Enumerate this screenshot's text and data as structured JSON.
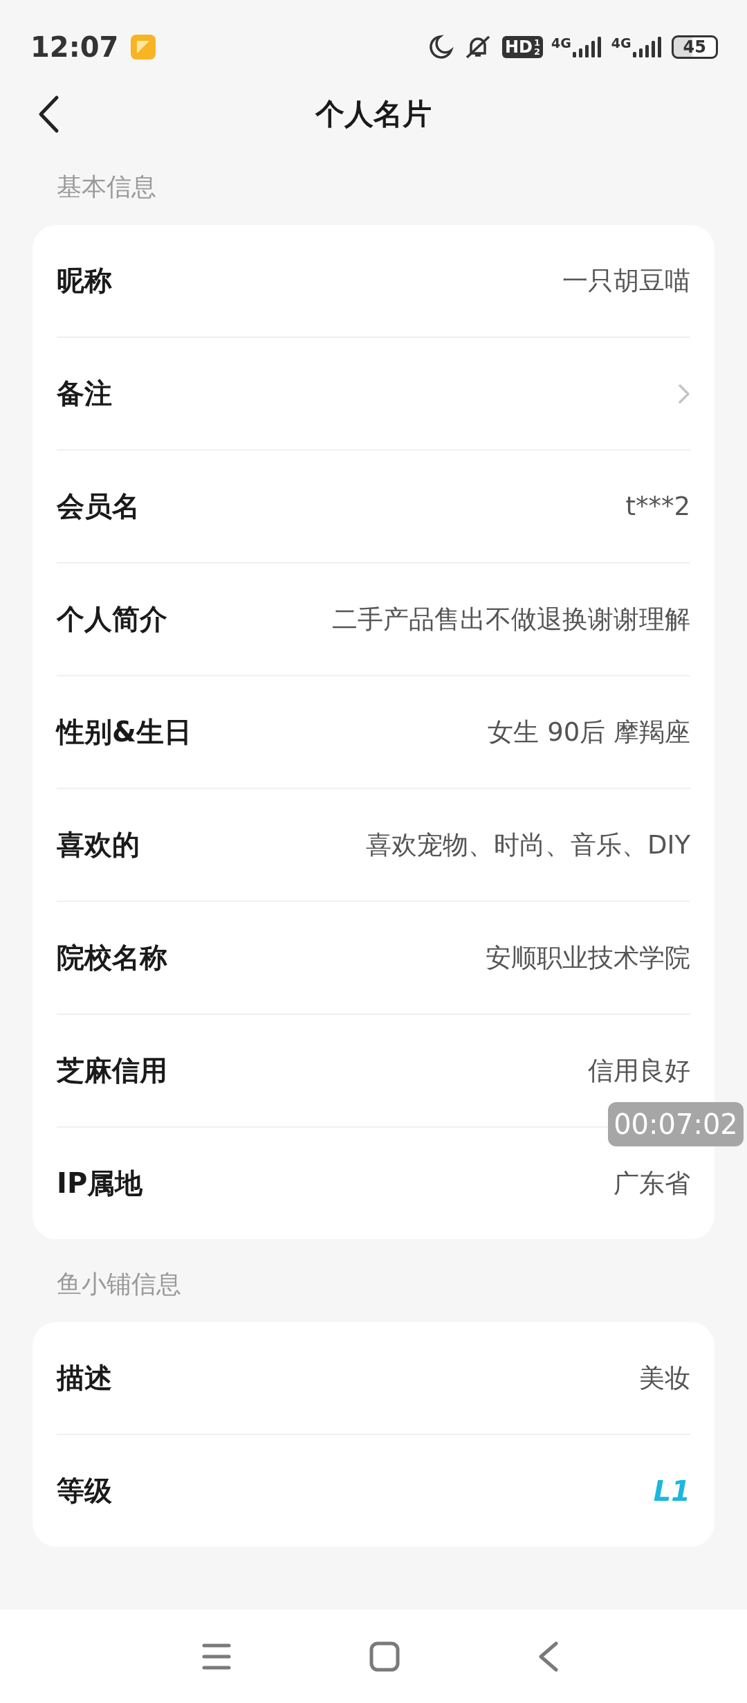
{
  "status_bar": {
    "time": "12:07",
    "hd_label": "HD",
    "hd_sup": "1",
    "hd_sub": "2",
    "network_1": "4G",
    "network_2": "4G",
    "battery": "45"
  },
  "header": {
    "title": "个人名片"
  },
  "sections": [
    {
      "title": "基本信息",
      "rows": [
        {
          "kind": "text",
          "label": "昵称",
          "value": "一只胡豆喵"
        },
        {
          "kind": "link",
          "label": "备注"
        },
        {
          "kind": "text",
          "label": "会员名",
          "value": "t***2"
        },
        {
          "kind": "text",
          "label": "个人简介",
          "value": "二手产品售出不做退换谢谢理解"
        },
        {
          "kind": "text",
          "label": "性别&生日",
          "value": "女生 90后 摩羯座"
        },
        {
          "kind": "text",
          "label": "喜欢的",
          "value": "喜欢宠物、时尚、音乐、DIY"
        },
        {
          "kind": "text",
          "label": "院校名称",
          "value": "安顺职业技术学院"
        },
        {
          "kind": "text",
          "label": "芝麻信用",
          "value": "信用良好"
        },
        {
          "kind": "text",
          "label": "IP属地",
          "value": "广东省"
        }
      ]
    },
    {
      "title": "鱼小铺信息",
      "rows": [
        {
          "kind": "text",
          "label": "描述",
          "value": "美妆"
        },
        {
          "kind": "badge",
          "label": "等级",
          "value": "L1"
        }
      ]
    }
  ],
  "timer_overlay": {
    "time": "00:07:02"
  }
}
